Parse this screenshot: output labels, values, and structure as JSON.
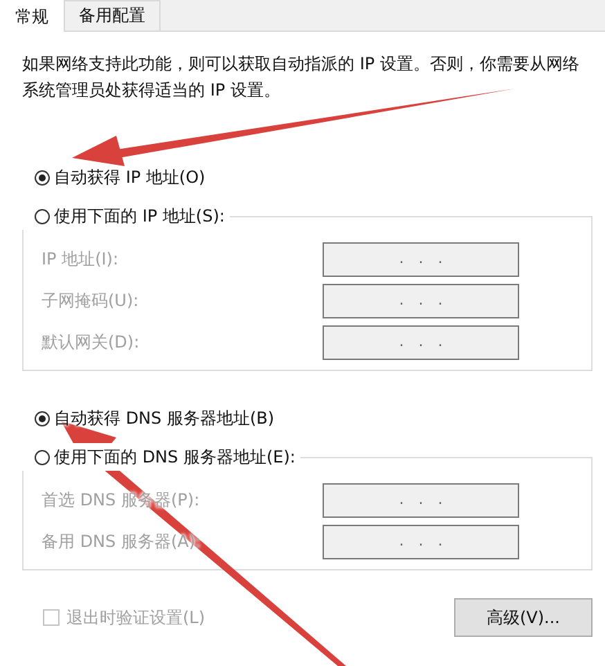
{
  "tabs": [
    {
      "label": "常规",
      "selected": true
    },
    {
      "label": "备用配置",
      "selected": false
    }
  ],
  "description": "如果网络支持此功能，则可以获取自动指派的 IP 设置。否则，你需要从网络系统管理员处获得适当的 IP 设置。",
  "ip_section": {
    "options": [
      {
        "label": "自动获得 IP 地址(O)",
        "selected": true
      },
      {
        "label": "使用下面的 IP 地址(S):",
        "selected": false
      }
    ],
    "fields": [
      {
        "label": "IP 地址(I):",
        "value": ".   .   .",
        "disabled": true
      },
      {
        "label": "子网掩码(U):",
        "value": ".   .   .",
        "disabled": true
      },
      {
        "label": "默认网关(D):",
        "value": ".   .   .",
        "disabled": true
      }
    ]
  },
  "dns_section": {
    "options": [
      {
        "label": "自动获得 DNS 服务器地址(B)",
        "selected": true
      },
      {
        "label": "使用下面的 DNS 服务器地址(E):",
        "selected": false
      }
    ],
    "fields": [
      {
        "label": "首选 DNS 服务器(P):",
        "value": ".   .   .",
        "disabled": true
      },
      {
        "label": "备用 DNS 服务器(A):",
        "value": ".   .   .",
        "disabled": true
      }
    ]
  },
  "validate_checkbox": {
    "label": "退出时验证设置(L)",
    "checked": false,
    "disabled": true
  },
  "advanced_button": "高级(V)..."
}
